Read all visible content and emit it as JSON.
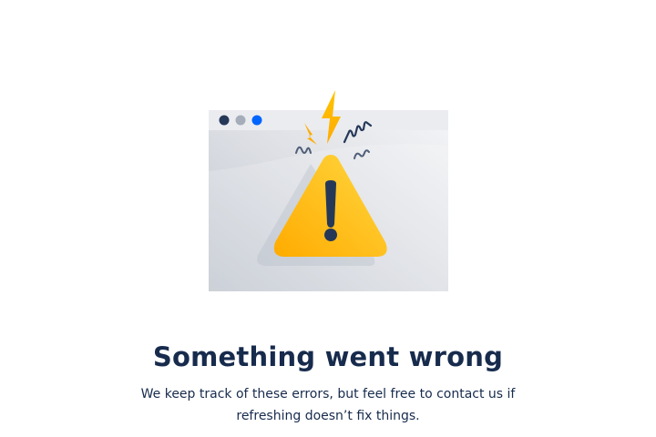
{
  "error_page": {
    "title": "Something went wrong",
    "message": "We keep track of these errors, but feel free to contact us if refreshing doesn’t fix things."
  },
  "illustration": {
    "window_dots": [
      {
        "name": "window-dot-dark",
        "color": "#253858"
      },
      {
        "name": "window-dot-gray",
        "color": "#a5adba"
      },
      {
        "name": "window-dot-blue",
        "color": "#0065ff"
      }
    ],
    "warning_color": "#ffab00",
    "warning_highlight": "#ffd740",
    "exclamation_color": "#253858",
    "icons": [
      "browser-window-icon",
      "warning-triangle-icon",
      "lightning-bolt-icon",
      "squiggle-icon"
    ]
  },
  "colors": {
    "text_primary": "#172b4d",
    "window_bar": "#ebecf0",
    "window_body": "#dfe1e6"
  }
}
